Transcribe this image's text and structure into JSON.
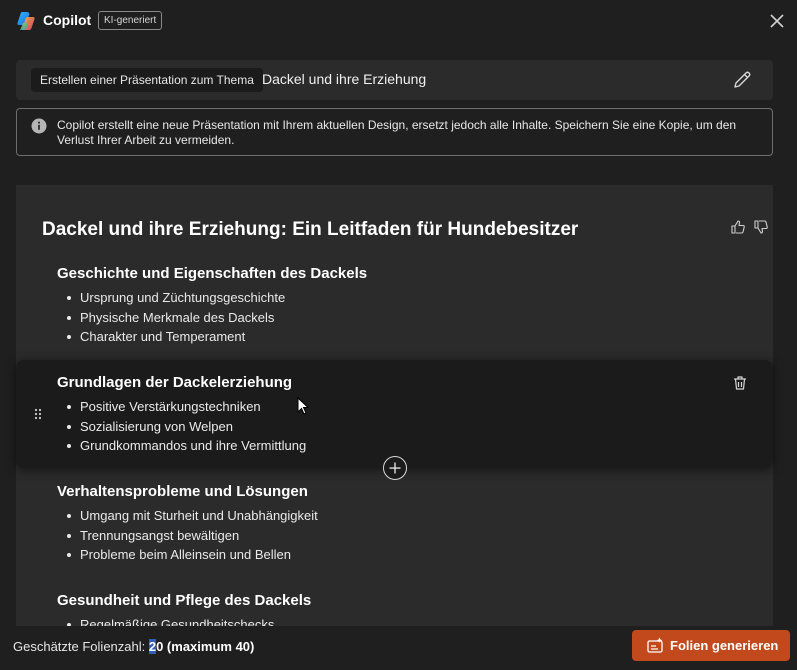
{
  "header": {
    "app_title": "Copilot",
    "ai_badge": "KI-generiert",
    "close_icon": "close-icon"
  },
  "prompt": {
    "chip_label": "Erstellen einer Präsentation zum Thema",
    "topic": "Dackel und ihre Erziehung",
    "edit_icon": "pencil-icon"
  },
  "notice": {
    "icon": "info-icon",
    "text": "Copilot erstellt eine neue Präsentation mit Ihrem aktuellen Design, ersetzt jedoch alle Inhalte. Speichern Sie eine Kopie, um den Verlust Ihrer Arbeit zu vermeiden."
  },
  "outline": {
    "title": "Dackel und ihre Erziehung: Ein Leitfaden für Hundebesitzer",
    "sections": [
      {
        "heading": "Geschichte und Eigenschaften des Dackels",
        "bullets": [
          "Ursprung und Züchtungsgeschichte",
          "Physische Merkmale des Dackels",
          "Charakter und Temperament"
        ]
      },
      {
        "heading": "Grundlagen der Dackelerziehung",
        "bullets": [
          "Positive Verstärkungstechniken",
          "Sozialisierung von Welpen",
          "Grundkommandos und ihre Vermittlung"
        ]
      },
      {
        "heading": "Verhaltensprobleme und Lösungen",
        "bullets": [
          "Umgang mit Sturheit und Unabhängigkeit",
          "Trennungsangst bewältigen",
          "Probleme beim Alleinsein und Bellen"
        ]
      },
      {
        "heading": "Gesundheit und Pflege des Dackels",
        "bullets": [
          "Regelmäßige Gesundheitschecks"
        ]
      }
    ]
  },
  "footer": {
    "count_prefix": "Geschätzte Folienzahl: ",
    "count_selected": "2",
    "count_rest": "0 (maximum 40)",
    "generate_label": "Folien generieren"
  },
  "colors": {
    "background": "#1f1f1f",
    "panel": "#2b2b2b",
    "active_section": "#1b1b1b",
    "accent": "#c2491c"
  }
}
